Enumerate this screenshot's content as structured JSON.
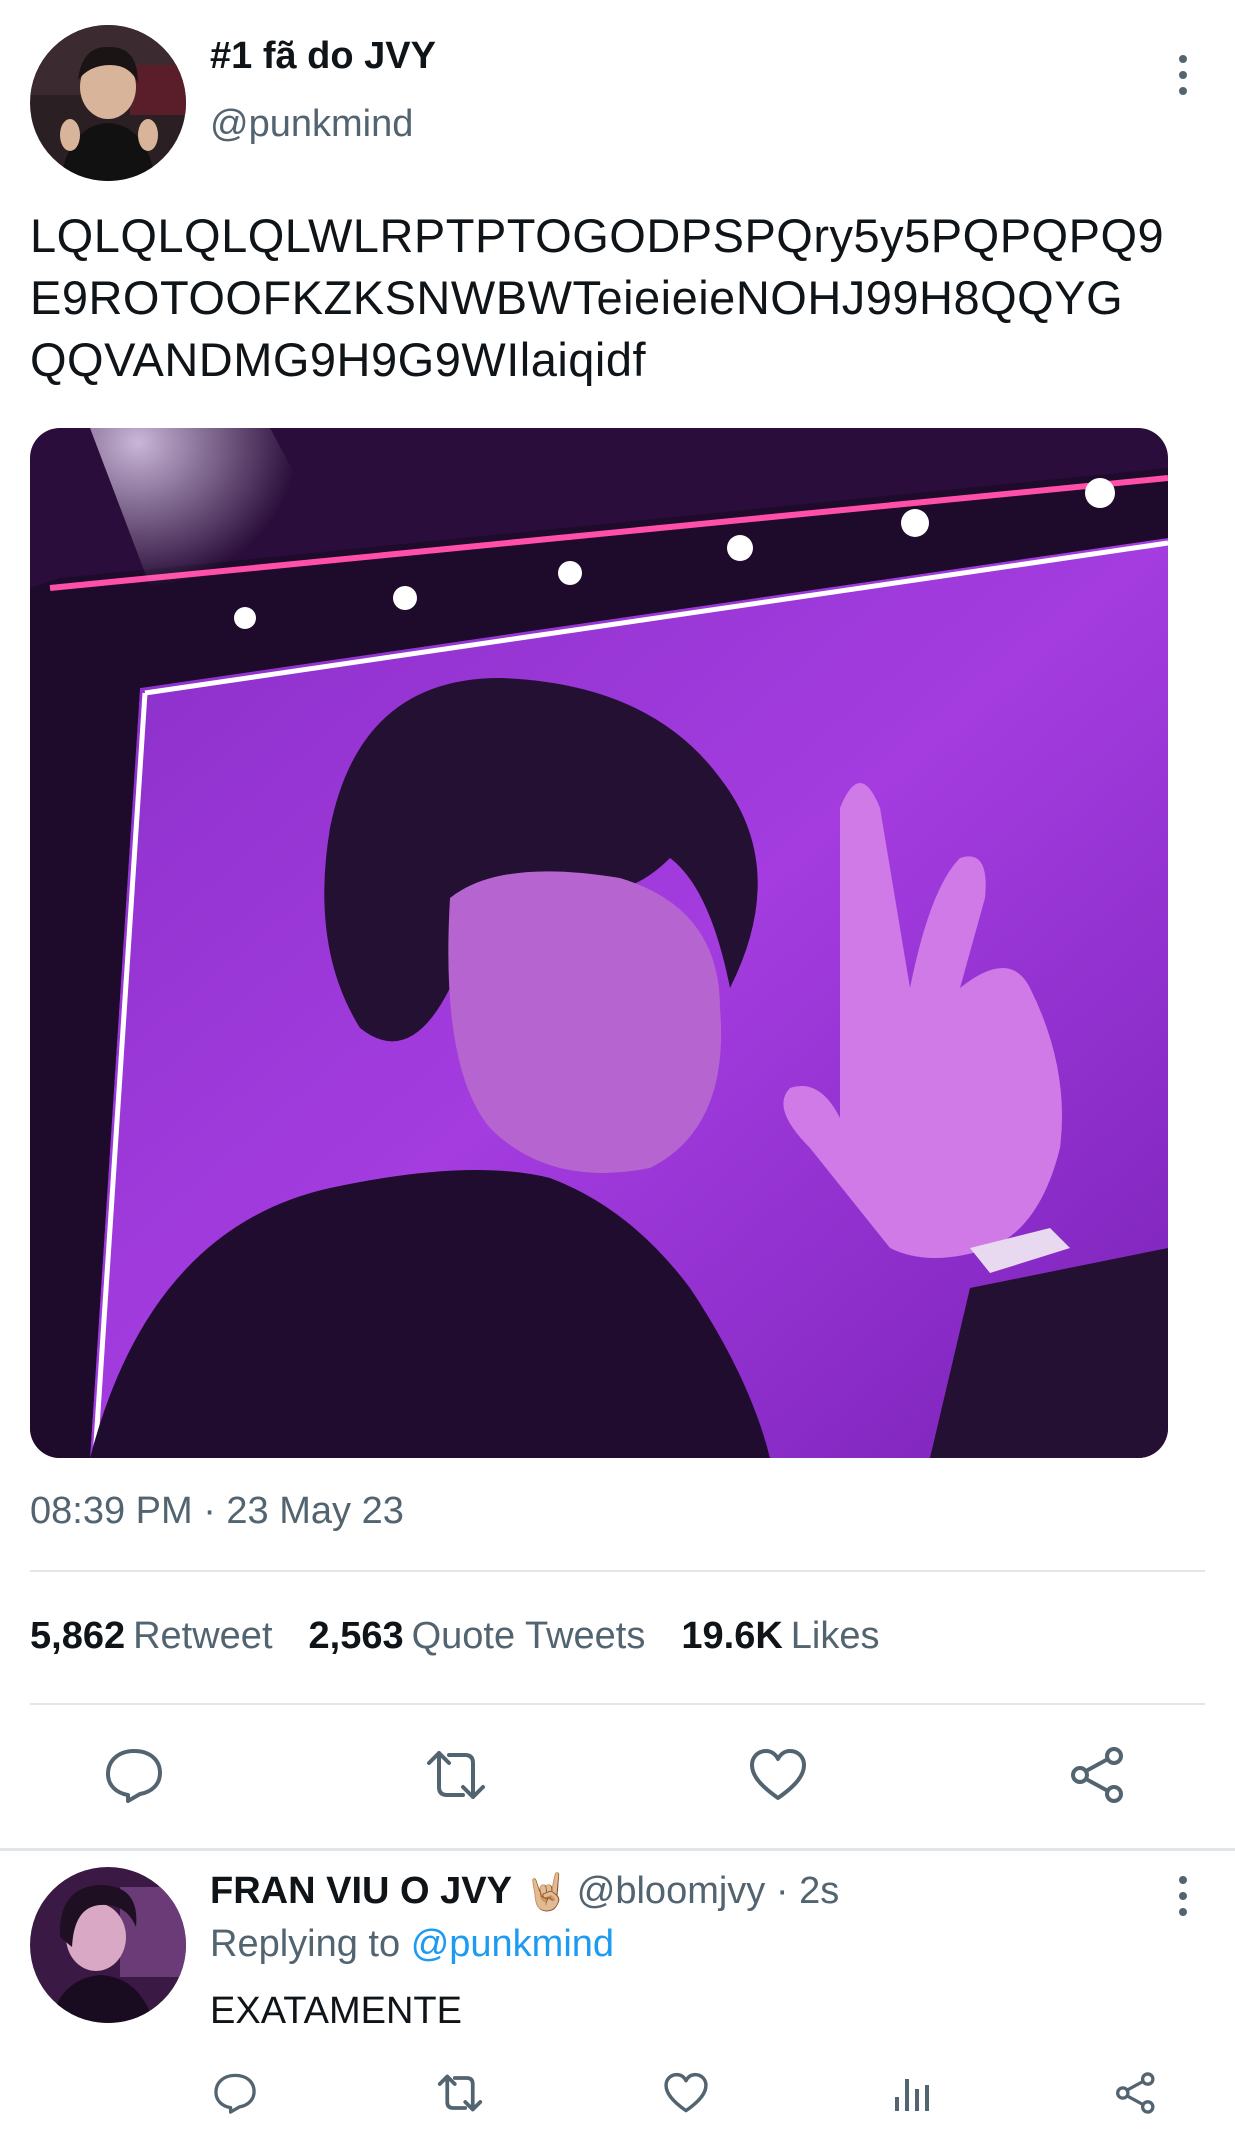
{
  "tweet": {
    "author_name": "#1 fã do JVY",
    "author_handle": "@punkmind",
    "text_lines": [
      "LQLQLQLQLWLRPTPTOGODPSPQry5y5PQPQPQ9",
      "E9ROTOOFKZKSNWBWTeieieieNOHJ99H8QQYG",
      "QQVANDMG9H9G9WIlaiqidf"
    ],
    "timestamp": "08:39 PM · 23 May 23",
    "stats": {
      "retweets": "5,862",
      "retweets_label": "Retweet",
      "quotes": "2,563",
      "quotes_label": "Quote Tweets",
      "likes": "19.6K",
      "likes_label": "Likes"
    },
    "actions": [
      "reply-icon",
      "retweet-icon",
      "like-icon",
      "share-icon"
    ],
    "media": {
      "dominant_color": "#9b2fd8"
    }
  },
  "reply": {
    "author_name": "FRAN VIU O JVY",
    "emoji": "🤘🏼",
    "author_handle": "@bloomjvy · 2s",
    "replying_prefix": "Replying to",
    "replying_to": "@punkmind",
    "text": "EXATAMENTE",
    "actions": [
      "reply-icon",
      "retweet-icon",
      "like-icon",
      "analytics-icon",
      "share-icon"
    ]
  },
  "colors": {
    "text": "#0f1419",
    "secondary": "#536471",
    "link": "#1d9bf0",
    "divider": "#e1e6ea"
  }
}
